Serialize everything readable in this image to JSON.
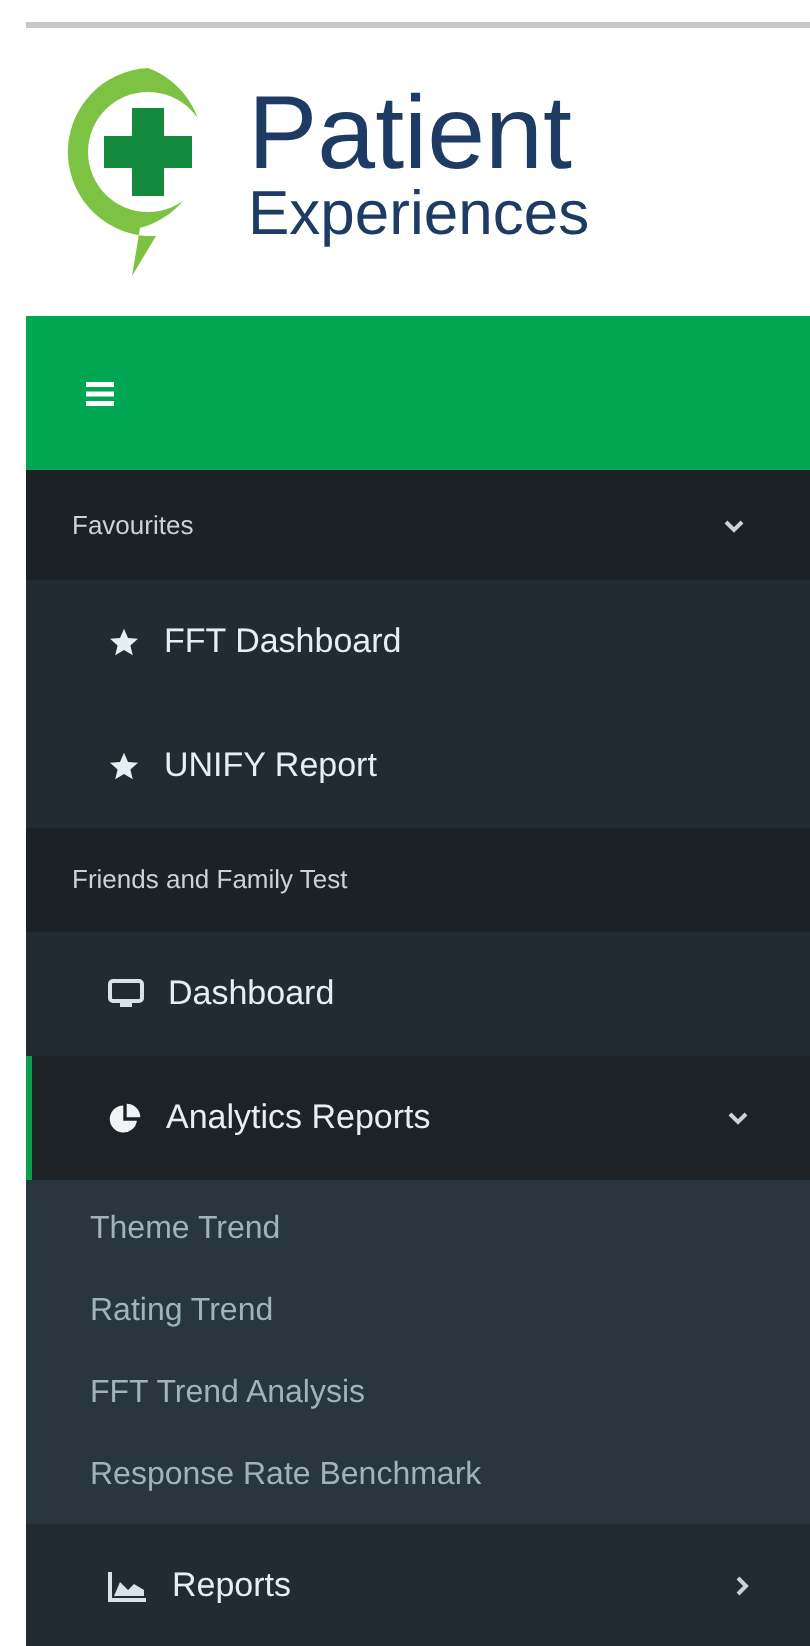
{
  "logo": {
    "line1": "Patient",
    "line2": "Experiences"
  },
  "sections": [
    {
      "title": "Favourites",
      "expanded": true,
      "items": [
        {
          "label": "FFT Dashboard",
          "kind": "favourite",
          "selected": false
        },
        {
          "label": "UNIFY Report",
          "kind": "favourite",
          "selected": false
        }
      ]
    },
    {
      "title": "Friends and Family Test",
      "items": [
        {
          "label": "Dashboard",
          "kind": "page",
          "selected": false
        },
        {
          "label": "Analytics Reports",
          "kind": "page",
          "selected": true,
          "expanded": true,
          "children": [
            {
              "label": "Theme Trend",
              "selected": false
            },
            {
              "label": "Rating Trend",
              "selected": false
            },
            {
              "label": "FFT Trend Analysis",
              "selected": false
            },
            {
              "label": "Response Rate Benchmark",
              "selected": false
            }
          ]
        },
        {
          "label": "Reports",
          "kind": "page",
          "selected": false,
          "expanded": false
        }
      ]
    }
  ]
}
